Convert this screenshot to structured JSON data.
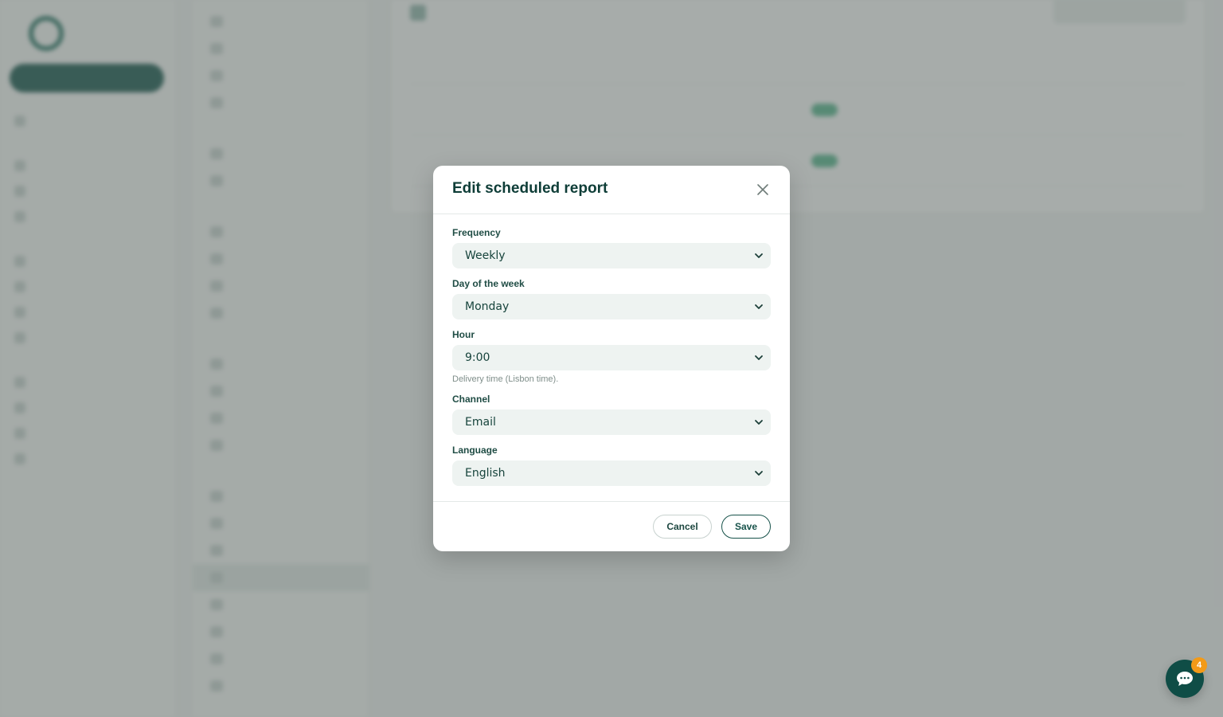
{
  "modal": {
    "title": "Edit scheduled report",
    "fields": [
      {
        "label": "Frequency",
        "value": "Weekly"
      },
      {
        "label": "Day of the week",
        "value": "Monday"
      },
      {
        "label": "Hour",
        "value": "9:00",
        "help": "Delivery time (Lisbon time)."
      },
      {
        "label": "Channel",
        "value": "Email"
      },
      {
        "label": "Language",
        "value": "English"
      }
    ],
    "cancel_label": "Cancel",
    "save_label": "Save"
  },
  "chat": {
    "badge_count": "4"
  },
  "colors": {
    "accent": "#0f4d46",
    "badge": "#f39a17",
    "overlay": "rgba(95,103,101,0.55)"
  },
  "icons": {
    "close": "close-icon",
    "chevron": "chevron-down-icon",
    "chat": "chat-bubble-icon"
  }
}
